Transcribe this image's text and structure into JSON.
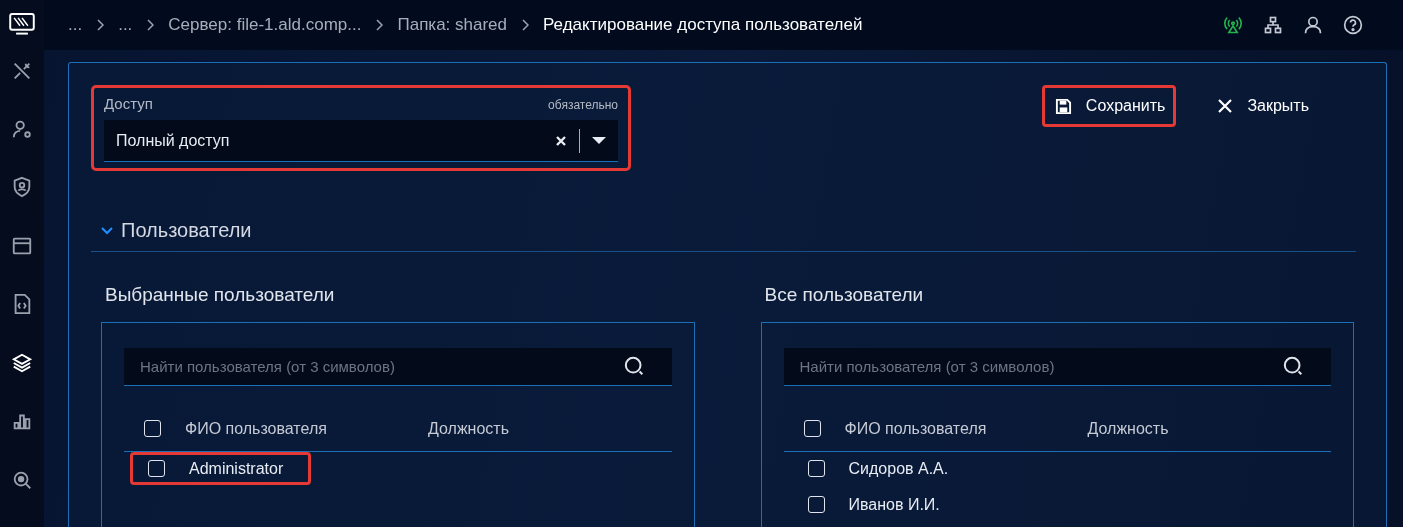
{
  "sidebar": {
    "items": [
      {
        "selected": false
      },
      {
        "selected": false
      },
      {
        "selected": false
      },
      {
        "selected": false
      },
      {
        "selected": false
      },
      {
        "selected": true
      },
      {
        "selected": false
      },
      {
        "selected": false
      }
    ]
  },
  "breadcrumbs": [
    {
      "label": "...",
      "current": false
    },
    {
      "label": "...",
      "current": false
    },
    {
      "label": "Сервер: file-1.ald.comp...",
      "current": false
    },
    {
      "label": "Папка: shared",
      "current": false
    },
    {
      "label": "Редактирование доступа пользователей",
      "current": true
    }
  ],
  "header_icons": [
    {
      "kind": "signal",
      "active": true
    },
    {
      "kind": "network",
      "active": false
    },
    {
      "kind": "user",
      "active": false
    },
    {
      "kind": "help",
      "active": false
    }
  ],
  "access_field": {
    "label": "Доступ",
    "required_note": "обязательно",
    "value": "Полный доступ",
    "highlighted": true
  },
  "actions": [
    {
      "kind": "save",
      "label": "Сохранить",
      "highlighted": true
    },
    {
      "kind": "close",
      "label": "Закрыть",
      "highlighted": false
    }
  ],
  "section": {
    "title": "Пользователи",
    "expanded": true
  },
  "panels": [
    {
      "title": "Выбранные пользователи",
      "search": {
        "placeholder": "Найти пользователя (от 3 символов)"
      },
      "columns": [
        "ФИО пользователя",
        "Должность"
      ],
      "all_checked": false,
      "rows": [
        {
          "name": "Administrator",
          "checked": false,
          "highlighted": true
        }
      ]
    },
    {
      "title": "Все пользователи",
      "search": {
        "placeholder": "Найти пользователя (от 3 символов)"
      },
      "columns": [
        "ФИО пользователя",
        "Должность"
      ],
      "all_checked": false,
      "rows": [
        {
          "name": "Сидоров А.А.",
          "checked": false,
          "highlighted": false
        },
        {
          "name": "Иванов И.И.",
          "checked": false,
          "highlighted": false
        }
      ]
    }
  ]
}
